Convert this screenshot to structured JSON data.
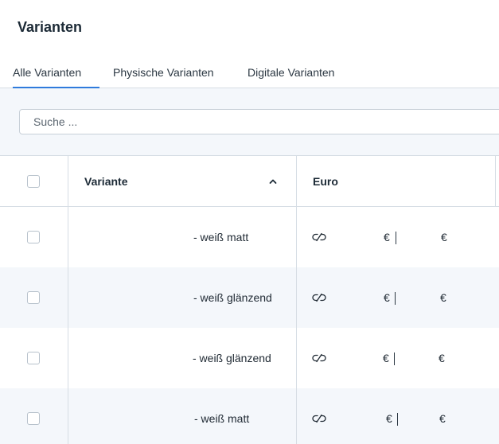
{
  "page": {
    "title": "Varianten"
  },
  "tabs": [
    {
      "label": "Alle Varianten",
      "active": true
    },
    {
      "label": "Physische Varianten",
      "active": false
    },
    {
      "label": "Digitale Varianten",
      "active": false
    }
  ],
  "search": {
    "placeholder": "Suche ..."
  },
  "table": {
    "columns": {
      "variant": "Variante",
      "currency": "Euro"
    },
    "sort": {
      "column": "variant",
      "direction": "ascending"
    },
    "currency_symbol": "€",
    "rows": [
      {
        "variant": "- weiß matt"
      },
      {
        "variant": "- weiß glänzend"
      },
      {
        "variant": "- weiß glänzend"
      },
      {
        "variant": "- weiß matt"
      }
    ]
  },
  "icons": {
    "sort": "chevron-up-icon",
    "price_link": "link-icon"
  },
  "colors": {
    "accent": "#2f7bdc",
    "stripe": "#f4f7fb",
    "border": "#d6dde4"
  }
}
